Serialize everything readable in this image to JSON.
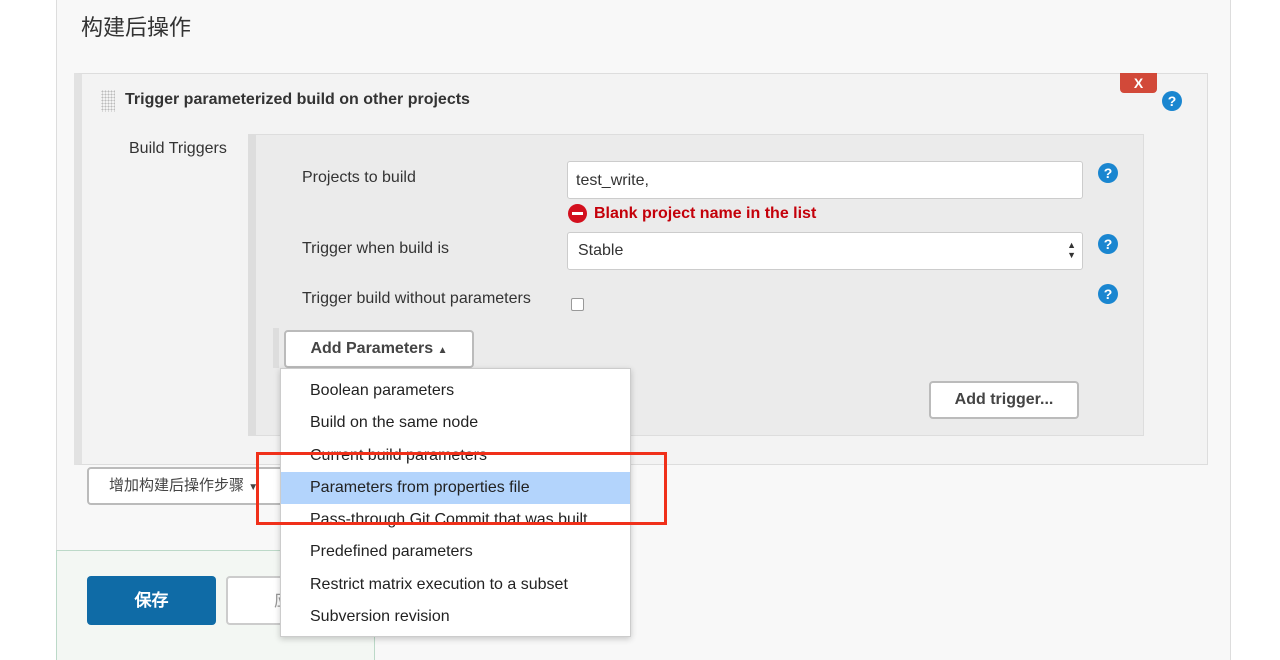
{
  "section_title": "构建后操作",
  "block": {
    "title": "Trigger parameterized build on other projects",
    "delete_label": "X",
    "help": "?"
  },
  "build_triggers": {
    "label": "Build Triggers",
    "projects_label": "Projects to build",
    "projects_value": "test_write,",
    "error": "Blank project name in the list",
    "trigger_when_label": "Trigger when build is",
    "trigger_when_value": "Stable",
    "without_params_label": "Trigger build without parameters",
    "without_params_checked": false,
    "add_parameters_label": "Add Parameters",
    "add_trigger_label": "Add trigger..."
  },
  "menu": {
    "items": [
      "Boolean parameters",
      "Build on the same node",
      "Current build parameters",
      "Parameters from properties file",
      "Pass-through Git Commit that was built",
      "Predefined parameters",
      "Restrict matrix execution to a subset",
      "Subversion revision"
    ],
    "selected": "Parameters from properties file"
  },
  "add_post_build_label": "增加构建后操作步骤",
  "footer": {
    "save_label": "保存",
    "apply_label": "应用"
  },
  "colors": {
    "save": "#0f6ba6",
    "error": "#c4000a",
    "highlight": "#f0301a",
    "selected": "#b3d4fc"
  }
}
